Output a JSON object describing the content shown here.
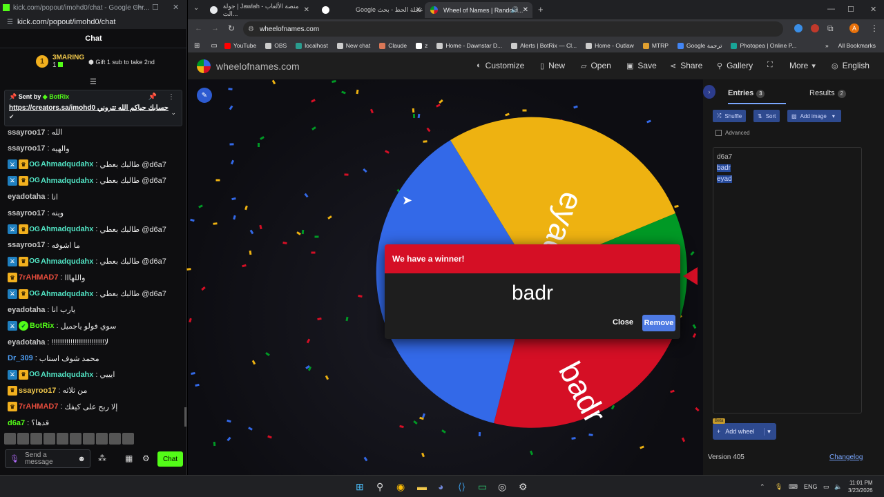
{
  "kick": {
    "window_title": "kick.com/popout/imohd0/chat - Google Chr...",
    "url": "kick.com/popout/imohd0/chat",
    "chat_header": "Chat",
    "gifter": {
      "rank": "1",
      "name": "3MARING",
      "count": "1"
    },
    "gift_action": "Gift 1 sub to take 2nd",
    "pinned": {
      "sent_by_label": "Sent by",
      "sent_by_user": "BotRix",
      "link": "https://creators.sa/imohd0",
      "link_suffix": "حسابك حياكم الله تتروني",
      "mark": "✔"
    },
    "messages": [
      {
        "user": "ssayroo17",
        "color": "#c9c9c9",
        "badges": [],
        "text": "الله"
      },
      {
        "user": "ssayroo17",
        "color": "#c9c9c9",
        "badges": [],
        "text": "والهيه"
      },
      {
        "user": "Ahmadqudahx",
        "color": "#52e5c5",
        "badges": [
          "mod",
          "crown",
          "og"
        ],
        "text": "طالبك بعطي @d6a7"
      },
      {
        "user": "Ahmadqudahx",
        "color": "#52e5c5",
        "badges": [
          "mod",
          "crown",
          "og"
        ],
        "text": "طالبك بعطي @d6a7"
      },
      {
        "user": "eyadotaha",
        "color": "#c9c9c9",
        "badges": [],
        "text": "انا"
      },
      {
        "user": "ssayroo17",
        "color": "#c9c9c9",
        "badges": [],
        "text": "وينه"
      },
      {
        "user": "Ahmadqudahx",
        "color": "#52e5c5",
        "badges": [
          "mod",
          "crown",
          "og"
        ],
        "text": "طالبك بعطي @d6a7"
      },
      {
        "user": "ssayroo17",
        "color": "#c9c9c9",
        "badges": [],
        "text": "ما اشوفه"
      },
      {
        "user": "Ahmadqudahx",
        "color": "#52e5c5",
        "badges": [
          "mod",
          "crown",
          "og"
        ],
        "text": "طالبك بعطي @d6a7"
      },
      {
        "user": "7rAHMAD7",
        "color": "#e74c3c",
        "badges": [
          "crown"
        ],
        "text": "واللهااا"
      },
      {
        "user": "Ahmadqudahx",
        "color": "#52e5c5",
        "badges": [
          "mod",
          "crown",
          "og"
        ],
        "text": "طالبك بعطي @d6a7"
      },
      {
        "user": "eyadotaha",
        "color": "#c9c9c9",
        "badges": [],
        "text": "يارب انا"
      },
      {
        "user": "BotRix",
        "color": "#53fc18",
        "badges": [
          "mod",
          "verified"
        ],
        "text": "سوي فولو ياجميل"
      },
      {
        "user": "eyadotaha",
        "color": "#c9c9c9",
        "badges": [],
        "text": "!!!!!!!!!!!!!!!!!!!!!!!!!لا"
      },
      {
        "user": "Dr_309",
        "color": "#4e9ff5",
        "badges": [],
        "text": "محمد شوف اسناب"
      },
      {
        "user": "Ahmadqudahx",
        "color": "#52e5c5",
        "badges": [
          "mod",
          "crown",
          "og"
        ],
        "text": "ايييي"
      },
      {
        "user": "ssayroo17",
        "color": "#f2c94c",
        "badges": [
          "crown"
        ],
        "text": "من ثلاثه"
      },
      {
        "user": "7rAHMAD7",
        "color": "#e74c3c",
        "badges": [
          "crown"
        ],
        "text": "إلا ربح على كيفك"
      },
      {
        "user": "d6a7",
        "color": "#53fc18",
        "badges": [],
        "text": "قدها؟"
      }
    ],
    "composer_placeholder": "Send a message",
    "chat_button": "Chat"
  },
  "chrome": {
    "tabs": [
      {
        "label": "جولة | Jawlah - منصة الألعاب الت...",
        "color": "#e8eaed"
      },
      {
        "label": "Google عجلة الحظ - بحث",
        "color": "#4285f4"
      },
      {
        "label": "Wheel of Names | Random...",
        "color": "#eeb211"
      }
    ],
    "url": "wheelofnames.com",
    "bookmarks": [
      {
        "label": "YouTube",
        "color": "#ff0000"
      },
      {
        "label": "OBS",
        "color": "#cccccc"
      },
      {
        "label": "localhost",
        "color": "#2a9d8f"
      },
      {
        "label": "New chat",
        "color": "#cccccc"
      },
      {
        "label": "Claude",
        "color": "#d97757"
      },
      {
        "label": "z",
        "color": "#ffffff"
      },
      {
        "label": "Home - Dawnstar D...",
        "color": "#cccccc"
      },
      {
        "label": "Alerts | BotRix — Cl...",
        "color": "#cccccc"
      },
      {
        "label": "Home - Outlaw",
        "color": "#cccccc"
      },
      {
        "label": "MTRP",
        "color": "#e0a030"
      },
      {
        "label": "Google ترجمة",
        "color": "#4285f4"
      },
      {
        "label": "Photopea | Online P...",
        "color": "#18a497"
      }
    ],
    "all_bookmarks": "All Bookmarks",
    "profile_initial": "A"
  },
  "won": {
    "site_title": "wheelofnames.com",
    "nav": [
      "Customize",
      "New",
      "Open",
      "Save",
      "Share",
      "Gallery",
      "More",
      "English"
    ],
    "panel": {
      "entries_tab": "Entries",
      "entries_count": "3",
      "results_tab": "Results",
      "results_count": "2",
      "shuffle": "Shuffle",
      "sort": "Sort",
      "add_image": "Add image",
      "advanced": "Advanced",
      "entries": [
        "d6a7",
        "badr",
        "eyad"
      ],
      "add_wheel": "Add wheel",
      "beta": "Beta",
      "version": "Version 405",
      "changelog": "Changelog"
    },
    "wheel": {
      "slices": [
        {
          "label": "eyad",
          "color": "#eeb211"
        },
        {
          "label": "d6a7",
          "color": "#009925"
        },
        {
          "label": "badr",
          "color": "#d50f25"
        },
        {
          "label": "",
          "color": "#3369e8"
        }
      ]
    },
    "modal": {
      "title": "We have a winner!",
      "winner": "badr",
      "close": "Close",
      "remove": "Remove"
    }
  },
  "taskbar": {
    "lang": "ENG",
    "time": "11:01 PM",
    "date": "3/23/2026"
  }
}
